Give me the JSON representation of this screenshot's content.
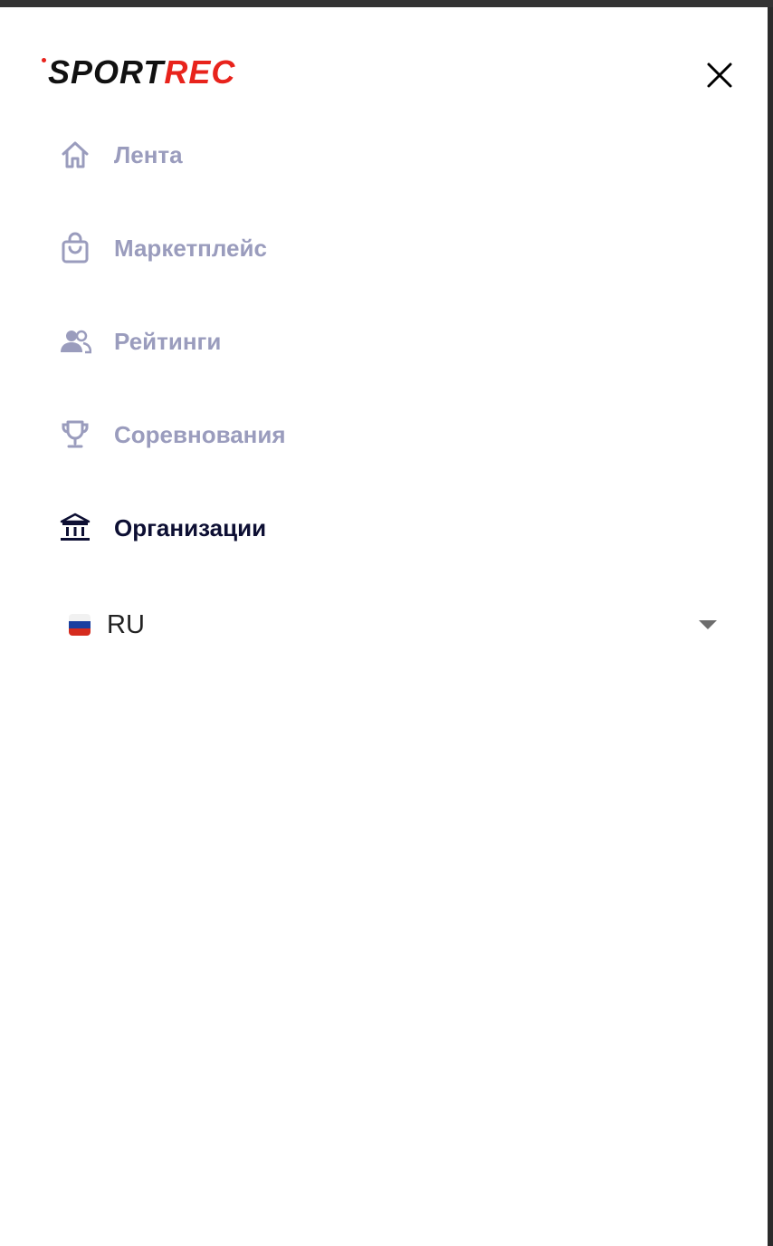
{
  "logo": {
    "part1": "SPORT",
    "part2": "REC",
    "accent_color": "#e8231c"
  },
  "close_icon": "close-icon",
  "nav": {
    "items": [
      {
        "label": "Лента",
        "icon": "home-icon",
        "active": false
      },
      {
        "label": "Маркетплейс",
        "icon": "shopping-bag-icon",
        "active": false
      },
      {
        "label": "Рейтинги",
        "icon": "users-icon",
        "active": false
      },
      {
        "label": "Соревнования",
        "icon": "trophy-icon",
        "active": false
      },
      {
        "label": "Организации",
        "icon": "institution-icon",
        "active": true
      }
    ],
    "inactive_color": "#9a9cbd",
    "active_color": "#0d0f33"
  },
  "language": {
    "selected": "RU",
    "flag_icon": "russia-flag-icon",
    "flag_colors": [
      "#f1f1f1",
      "#1a3fa0",
      "#d52b1e"
    ]
  }
}
